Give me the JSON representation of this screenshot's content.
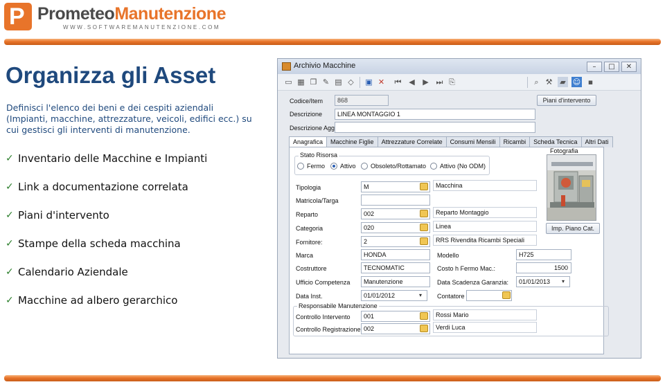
{
  "header": {
    "logo_letter": "P",
    "brand_part1": "Prometeo",
    "brand_part2": "Manutenzione",
    "url": "WWW.SOFTWAREMANUTENZIONE.COM",
    "accent_color": "#e8742a"
  },
  "slide": {
    "title": "Organizza gli Asset",
    "intro": "Definisci l'elenco dei beni e dei cespiti aziendali (Impianti, macchine, attrezzature, veicoli, edifici ecc.) su cui gestisci gli interventi di manutenzione.",
    "bullets": [
      "Inventario delle Macchine e Impianti",
      "Link a documentazione correlata",
      "Piani d'intervento",
      "Stampe della scheda macchina",
      "Calendario Aziendale",
      "Macchine ad albero gerarchico"
    ],
    "title_color": "#1f497d"
  },
  "app": {
    "title": "Archivio Macchine",
    "window_buttons": [
      "minimize-icon",
      "maximize-icon",
      "close-icon"
    ],
    "toolbar_icons": [
      "new-icon",
      "grid-icon",
      "copy-icon",
      "edit-icon",
      "delete-record-icon",
      "save-icon",
      "cancel-icon",
      "first-icon",
      "prev-icon",
      "next-icon",
      "last-icon",
      "attach-icon",
      "search-icon",
      "tools-icon",
      "folder-icon",
      "user-icon",
      "lock-icon"
    ],
    "codice_label": "Codice/Item",
    "codice_value": "868",
    "descrizione_label": "Descrizione",
    "descrizione_value": "LINEA MONTAGGIO 1",
    "descrizione_agg_label": "Descrizione Agg.",
    "descrizione_agg_value": "",
    "piani_button": "Piani d'intervento",
    "tabs": [
      "Anagrafica",
      "Macchine Figlie",
      "Attrezzature Correlate",
      "Consumi Mensili",
      "Ricambi",
      "Scheda Tecnica",
      "Altri Dati"
    ],
    "stato_title": "Stato Risorsa",
    "stato_options": [
      "Fermo",
      "Attivo",
      "Obsoleto/Rottamato",
      "Attivo (No ODM)"
    ],
    "stato_selected": "Attivo",
    "fotografia_label": "Fotografia",
    "imp_piano_button": "Imp. Piano Cat.",
    "tipologia_label": "Tipologia",
    "tipologia_code": "M",
    "tipologia_desc": "Macchina",
    "matricola_label": "Matricola/Targa",
    "matricola_value": "",
    "reparto_label": "Reparto",
    "reparto_code": "002",
    "reparto_desc": "Reparto Montaggio",
    "categoria_label": "Categoria",
    "categoria_code": "020",
    "categoria_desc": "Linea",
    "fornitore_label": "Fornitore:",
    "fornitore_code": "2",
    "fornitore_desc": "RRS Rivendita Ricambi Speciali",
    "marca_label": "Marca",
    "marca_value": "HONDA",
    "modello_label": "Modello",
    "modello_value": "H725",
    "costruttore_label": "Costruttore",
    "costruttore_value": "TECNOMATIC",
    "costo_label": "Costo h Fermo Mac.:",
    "costo_value": "1500",
    "ufficio_label": "Ufficio Competenza",
    "ufficio_value": "Manutenzione",
    "scadenza_label": "Data Scadenza Garanzia:",
    "scadenza_value": "01/01/2013",
    "data_inst_label": "Data Inst.",
    "data_inst_value": "01/01/2012",
    "contatore_label": "Contatore",
    "contatore_value": "",
    "resp_title": "Responsabile Manutenzione",
    "controllo_int_label": "Controllo Intervento",
    "controllo_int_code": "001",
    "controllo_int_name": "Rossi Mario",
    "controllo_reg_label": "Controllo Registrazione",
    "controllo_reg_code": "002",
    "controllo_reg_name": "Verdi Luca"
  }
}
